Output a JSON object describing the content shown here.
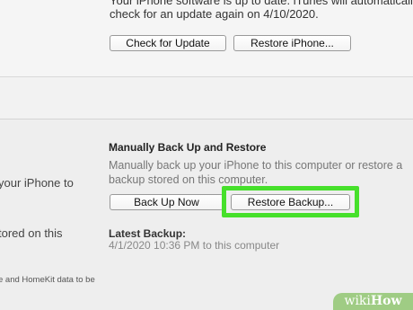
{
  "software_update": {
    "line1": "Your iPhone software is up to date. iTunes will automatically",
    "line2": "check for an update again on 4/10/2020.",
    "check_button": "Check for Update",
    "restore_button": "Restore iPhone..."
  },
  "manual_backup": {
    "heading": "Manually Back Up and Restore",
    "description_line1": "Manually back up your iPhone to this computer or restore a",
    "description_line2": "backup stored on this computer.",
    "back_up_button": "Back Up Now",
    "restore_backup_button": "Restore Backup...",
    "latest_label": "Latest Backup:",
    "latest_value": "4/1/2020 10:36 PM to this computer"
  },
  "left_column": {
    "line1": "your iPhone to",
    "line2": "tored on this",
    "line3": "e and HomeKit data to be"
  },
  "watermark": {
    "prefix": "wiki",
    "suffix": "How"
  },
  "colors": {
    "highlight": "#46e02b",
    "watermark_bg": "#96c878"
  }
}
